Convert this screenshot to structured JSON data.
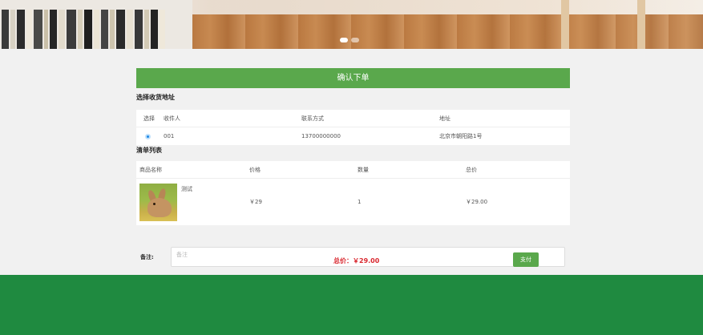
{
  "carousel": {
    "slide_count": 2,
    "active_index": 0
  },
  "order": {
    "confirm_title": "确认下单",
    "address_section_title": "选择收货地址",
    "address_table": {
      "headers": [
        "选择",
        "收件人",
        "联系方式",
        "地址"
      ],
      "rows": [
        {
          "selected": true,
          "recipient": "001",
          "phone": "13700000000",
          "address": "北京市朝阳路1号"
        }
      ]
    },
    "goods_section_title": "清单列表",
    "goods_table": {
      "headers": [
        "商品名称",
        "价格",
        "数量",
        "总价"
      ],
      "rows": [
        {
          "name": "测试",
          "price": "￥29",
          "quantity": "1",
          "subtotal": "￥29.00",
          "image": "rabbit-photo"
        }
      ]
    },
    "remark": {
      "label": "备注:",
      "placeholder": "备注",
      "value": ""
    },
    "total_text": "总价：￥29.00",
    "pay_label": "支付"
  },
  "colors": {
    "accent": "#5aa84c",
    "footer": "#1f8a40",
    "price_red": "#d9282f",
    "radio_blue": "#1e88e5"
  }
}
